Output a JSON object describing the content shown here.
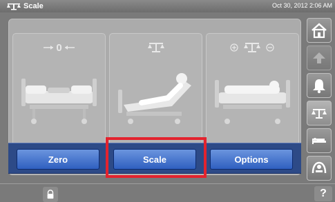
{
  "header": {
    "title": "Scale",
    "datetime": "Oct 30, 2012 2:06 AM",
    "app_icon": "scale-icon"
  },
  "panels": [
    {
      "glyph": "zero-arrows-icon",
      "glyph_text": "0",
      "image": "bed-flat-icon"
    },
    {
      "glyph": "scale-icon",
      "image": "bed-inclined-icon"
    },
    {
      "glyph": "scale-plus-minus-icon",
      "image": "bed-with-patient-icon"
    }
  ],
  "buttons": {
    "zero_label": "Zero",
    "scale_label": "Scale",
    "options_label": "Options"
  },
  "sidebar": {
    "items": [
      "home-icon",
      "bed-up-icon",
      "alarm-bell-icon",
      "scale-icon",
      "bed-position-icon",
      "bed-exit-icon"
    ]
  },
  "footer": {
    "lock_icon": "lock-icon",
    "help_label": "?"
  },
  "colors": {
    "button_blue": "#3a6ad0",
    "button_bar": "#2d4a87",
    "highlight_red": "#e3232e",
    "panel_gray": "#b4b4b4"
  }
}
